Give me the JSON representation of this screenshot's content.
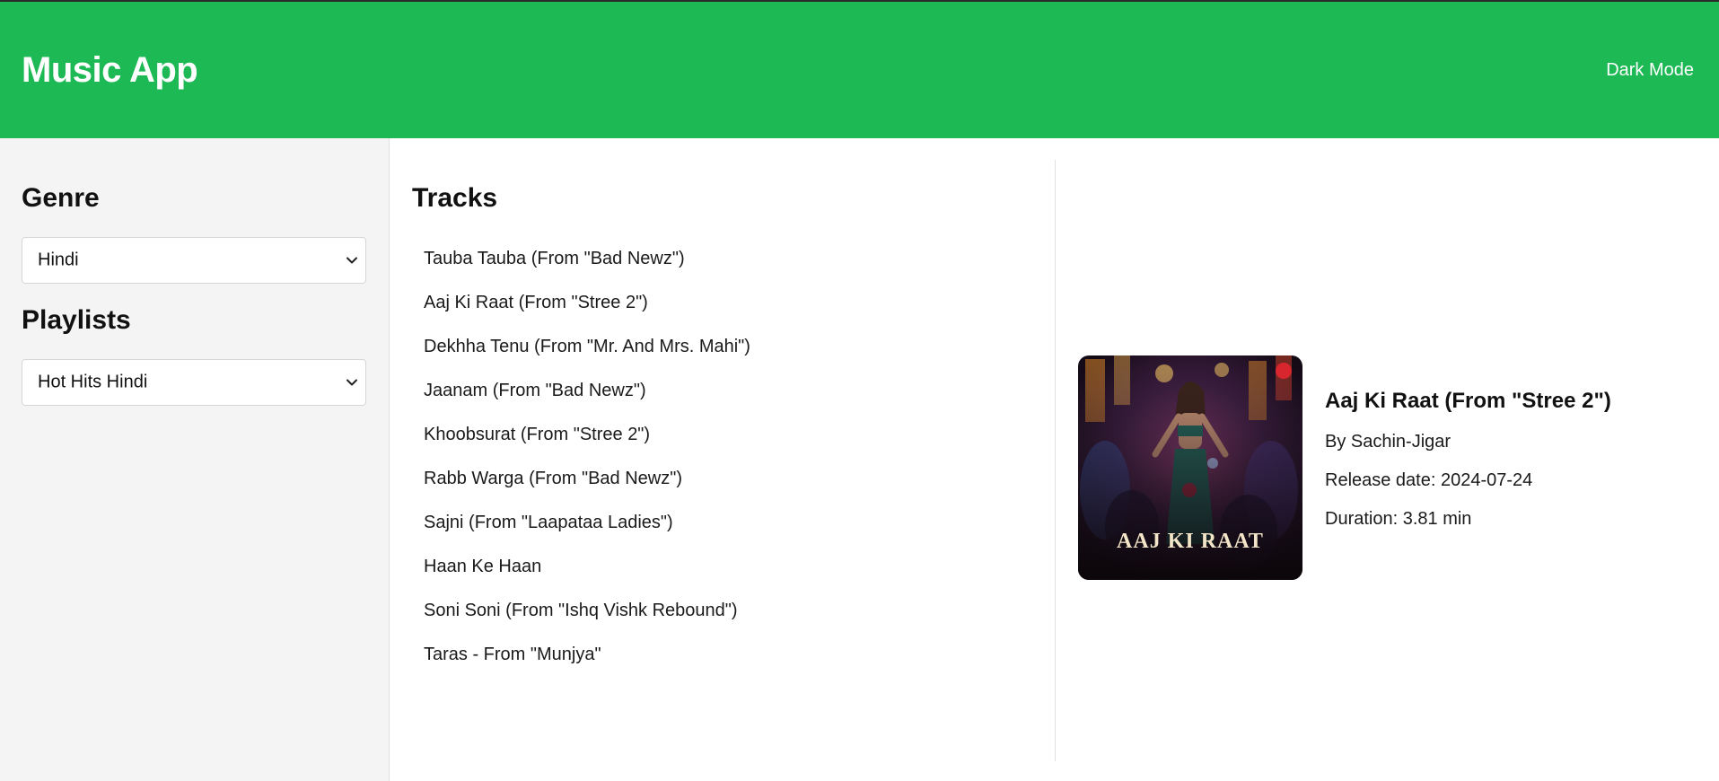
{
  "header": {
    "app_title": "Music App",
    "dark_mode_label": "Dark Mode",
    "background_color": "#1db954"
  },
  "sidebar": {
    "genre_heading": "Genre",
    "genre_selected": "Hindi",
    "playlists_heading": "Playlists",
    "playlist_selected": "Hot Hits Hindi"
  },
  "tracks": {
    "heading": "Tracks",
    "items": [
      "Tauba Tauba (From \"Bad Newz\")",
      "Aaj Ki Raat (From \"Stree 2\")",
      "Dekhha Tenu (From \"Mr. And Mrs. Mahi\")",
      "Jaanam (From \"Bad Newz\")",
      "Khoobsurat (From \"Stree 2\")",
      "Rabb Warga (From \"Bad Newz\")",
      "Sajni (From \"Laapataa Ladies\")",
      "Haan Ke Haan",
      "Soni Soni (From \"Ishq Vishk Rebound\")",
      "Taras - From \"Munjya\""
    ]
  },
  "detail": {
    "title": "Aaj Ki Raat (From \"Stree 2\")",
    "artist": "By Sachin-Jigar",
    "release": "Release date: 2024-07-24",
    "duration": "Duration: 3.81 min",
    "cover_text": "AAJ KI RAAT"
  }
}
